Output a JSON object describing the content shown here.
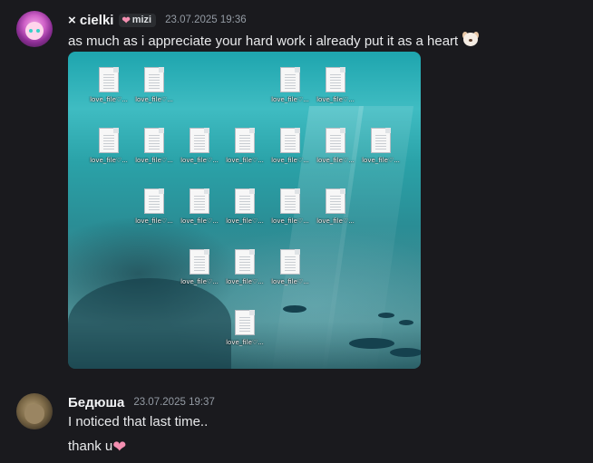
{
  "messages": [
    {
      "username": "× cielki",
      "tag_label": "mizi",
      "timestamp": "23.07.2025 19:36",
      "text": "as much as i appreciate your hard work i already put it as a heart",
      "trailing_emoji": "dog-emoji"
    },
    {
      "username": "Бедюша",
      "timestamp": "23.07.2025 19:37",
      "lines": [
        "I noticed that last time..",
        "thank u"
      ],
      "trailing_emoji": "pink-heart-emoji"
    }
  ],
  "attachment": {
    "file_label": "love_file♡...",
    "file_grid_rows": [
      [
        1,
        1,
        0,
        0,
        1,
        1,
        0
      ],
      [
        1,
        1,
        1,
        1,
        1,
        1,
        1
      ],
      [
        0,
        1,
        1,
        1,
        1,
        1,
        0
      ],
      [
        0,
        0,
        1,
        1,
        1,
        0,
        0
      ],
      [
        0,
        0,
        0,
        1,
        0,
        0,
        0
      ]
    ]
  },
  "colors": {
    "background": "#1a1a1e",
    "text": "#dbdee1",
    "timestamp": "#949ba4",
    "heart": "#f48fb1",
    "water": "#2aa2a8"
  }
}
